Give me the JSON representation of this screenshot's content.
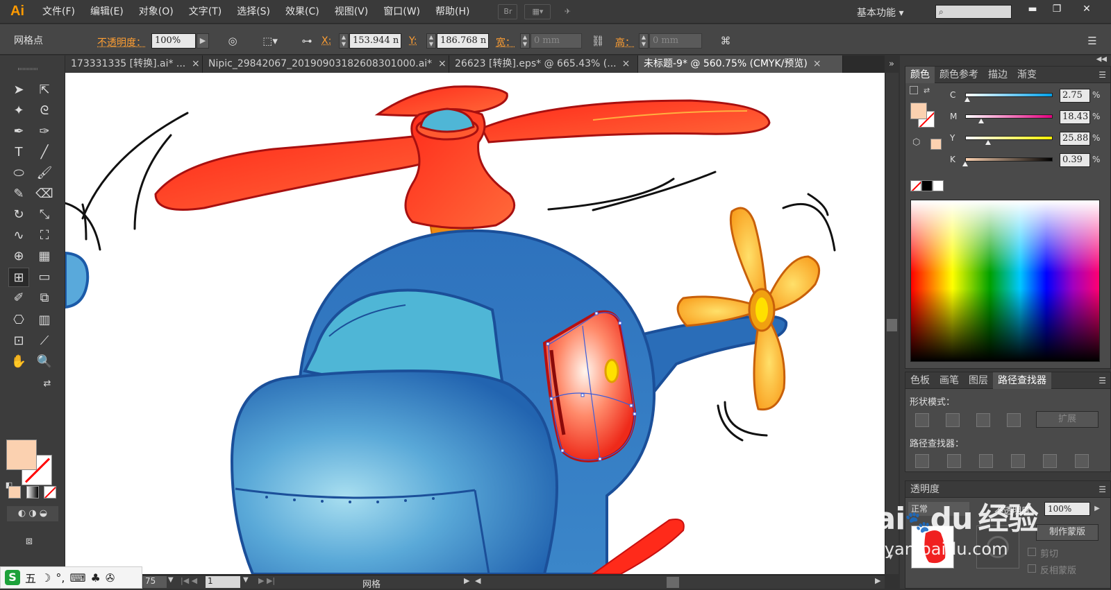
{
  "app": {
    "logo": "Ai"
  },
  "menu": [
    "文件(F)",
    "编辑(E)",
    "对象(O)",
    "文字(T)",
    "选择(S)",
    "效果(C)",
    "视图(V)",
    "窗口(W)",
    "帮助(H)"
  ],
  "menubar": {
    "bridge_label": "Br",
    "workspace": "基本功能",
    "search_placeholder": "",
    "min": "▬",
    "restore": "❐",
    "close": "✕"
  },
  "control": {
    "selection_label": "网格点",
    "opacity_label": "不透明度：",
    "opacity_value": "100%",
    "x_label": "X:",
    "x_value": "153.944 n",
    "y_label": "Y:",
    "y_value": "186.768 n",
    "width_label": "宽：",
    "width_value": "0 mm",
    "height_label": "高：",
    "height_value": "0 mm"
  },
  "tabs": [
    {
      "label": "173331335 [转换].ai* ...",
      "active": false
    },
    {
      "label": "Nipic_29842067_20190903182608301000.ai*",
      "active": false
    },
    {
      "label": "26623 [转换].eps* @ 665.43% (...",
      "active": false
    },
    {
      "label": "未标题-9* @ 560.75% (CMYK/预览)",
      "active": true
    }
  ],
  "tab_close": "×",
  "color_panel": {
    "tabs": [
      "颜色",
      "颜色参考",
      "描边",
      "渐变"
    ],
    "channels": [
      {
        "label": "C",
        "value": "2.75",
        "pct": "%",
        "level": 0.0275,
        "gradient": "linear-gradient(to right,#fff,#00a0e9)"
      },
      {
        "label": "M",
        "value": "18.43",
        "pct": "%",
        "level": 0.1843,
        "gradient": "linear-gradient(to right,#fff,#e4007f)"
      },
      {
        "label": "Y",
        "value": "25.88",
        "pct": "%",
        "level": 0.2588,
        "gradient": "linear-gradient(to right,#fff,#fff100)"
      },
      {
        "label": "K",
        "value": "0.39",
        "pct": "%",
        "level": 0.0039,
        "gradient": "linear-gradient(to right,#fbd1b0,#000)"
      }
    ],
    "fill_color": "#fbd1b0"
  },
  "pathfinder_panel": {
    "tabs": [
      "色板",
      "画笔",
      "图层",
      "路径查找器"
    ],
    "shape_modes_label": "形状模式：",
    "expand_label": "扩展",
    "pathfinders_label": "路径查找器："
  },
  "transparency_panel": {
    "title": "透明度",
    "mode_label": "正常",
    "opacity_label": "不透明度",
    "opacity_value": "100%",
    "make_mask": "制作蒙版",
    "clip": "剪切",
    "invert_mask": "反相蒙版"
  },
  "status": {
    "zoom": "75",
    "page": "1",
    "mode": "网格"
  },
  "ime": {
    "logo": "S",
    "label": "五"
  },
  "watermark": {
    "brand": "Bai",
    "brand2": "du",
    "site": "经验",
    "url": "jingyan.baidu.com"
  }
}
